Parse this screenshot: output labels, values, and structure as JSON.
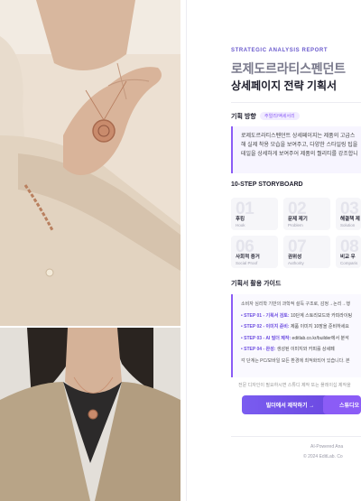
{
  "report": {
    "eyebrow": "STRATEGIC ANALYSIS REPORT",
    "brand": "로제도르라티스펜던트",
    "title": "상세페이지 전략 기획서"
  },
  "direction": {
    "label": "기획 방향",
    "tag": "주얼리/액세서리",
    "lines": [
      "로제도르라티스펜던트 상세페이지는 제품의 고급스",
      "해 실제 착용 모습을 보여주고, 다양한 스타일링 팁을",
      "테일을 상세하게 보여주어 제품의 퀄리티를 강조합니"
    ]
  },
  "storyboard": {
    "label": "10-STEP STORYBOARD",
    "cards": [
      {
        "num": "01",
        "kr": "후킹",
        "en": "Hook"
      },
      {
        "num": "02",
        "kr": "문제 제기",
        "en": "Problem"
      },
      {
        "num": "03",
        "kr": "해결책 제",
        "en": "Solution"
      },
      {
        "num": "06",
        "kr": "사회적 증거",
        "en": "Social Proof"
      },
      {
        "num": "07",
        "kr": "권위성",
        "en": "Authority"
      },
      {
        "num": "08",
        "kr": "비교 우",
        "en": "Comparis"
      }
    ]
  },
  "guide": {
    "label": "기획서 활용 가이드",
    "intro": "소비자 심리학 기반의 과학적 설득 구조로, 감정→논리→행",
    "steps": [
      {
        "step": "• STEP 01 - 기획서 검토:",
        "text": " 10단계 스토리보드와 카피라이팅"
      },
      {
        "step": "• STEP 02 - 이미지 준비:",
        "text": " 제품 이미지 10장을 준비하세요"
      },
      {
        "step": "• STEP 03 - AI 빌더 제작:",
        "text": " editlab.co.kr/builder에서 분석"
      },
      {
        "step": "• STEP 04 - 완성:",
        "text": " 생성된 이미지와 카피를 상세페"
      }
    ],
    "outro": "각 단계는 PC/모바일 모든 환경에 최적화되어 있습니다. 본 "
  },
  "note": "전문 디자인이 필요하시면 스튜디 제작 또는 플레이십 제작을",
  "buttons": {
    "primary": "빌더에서 제작하기 →",
    "secondary": "스튜디오 제"
  },
  "footer": {
    "line1": "AI-Powered Ana",
    "line2": "© 2024 EditLab. Co"
  },
  "colors": {
    "accent": "#8b5cf6",
    "accent_dark": "#6a48e0",
    "brand_gray": "#7a7a8c"
  }
}
